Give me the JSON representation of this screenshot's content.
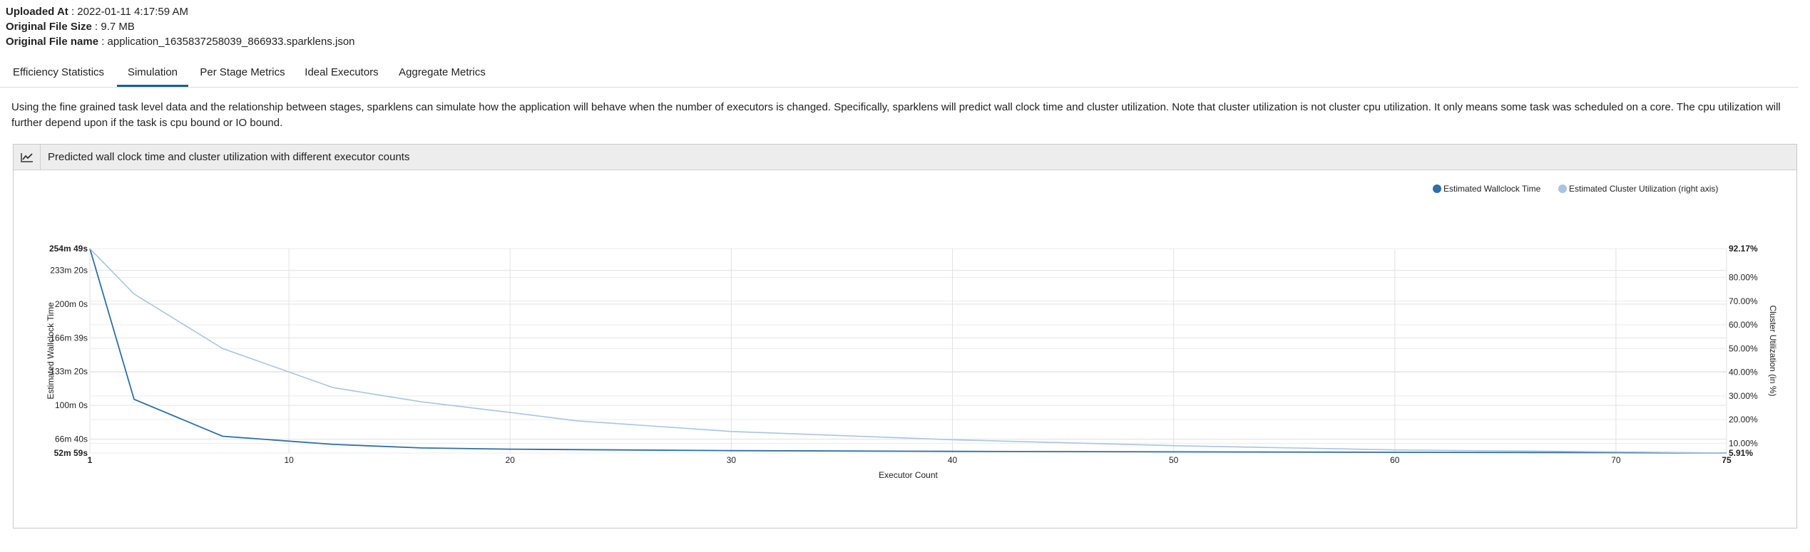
{
  "meta": {
    "uploaded_label": "Uploaded At",
    "uploaded_value": " : 2022-01-11 4:17:59 AM",
    "size_label": "Original File Size",
    "size_value": " : 9.7 MB",
    "name_label": "Original File name",
    "name_value": " : application_1635837258039_866933.sparklens.json"
  },
  "tabs": [
    {
      "label": "Efficiency Statistics"
    },
    {
      "label": "Simulation"
    },
    {
      "label": "Per Stage Metrics"
    },
    {
      "label": "Ideal Executors"
    },
    {
      "label": "Aggregate Metrics"
    }
  ],
  "active_tab": "Simulation",
  "description": "Using the fine grained task level data and the relationship between stages, sparklens can simulate how the application will behave when the number of executors is changed. Specifically, sparklens will predict wall clock time and cluster utilization. Note that cluster utilization is not cluster cpu utilization. It only means some task was scheduled on a core. The cpu utilization will further depend upon if the task is cpu bound or IO bound.",
  "panel": {
    "icon": "line-chart-icon",
    "title": "Predicted wall clock time and cluster utilization with different executor counts"
  },
  "chart_data": {
    "type": "line",
    "xlabel": "Executor Count",
    "ylabel_left": "Estimated Wallclock Time",
    "ylabel_right": "Cluster Utilization (in %)",
    "x_ticks": [
      1,
      10,
      20,
      30,
      40,
      50,
      60,
      70,
      75
    ],
    "x_range": [
      1,
      75
    ],
    "y_left_range_minutes": [
      52.983,
      254.817
    ],
    "y_left_ticks": [
      {
        "value": 254.817,
        "label": "254m 49s",
        "bold": true
      },
      {
        "value": 233.333,
        "label": "233m 20s"
      },
      {
        "value": 200.0,
        "label": "200m 0s"
      },
      {
        "value": 166.65,
        "label": "166m 39s"
      },
      {
        "value": 133.333,
        "label": "133m 20s"
      },
      {
        "value": 100.0,
        "label": "100m 0s"
      },
      {
        "value": 66.667,
        "label": "66m 40s"
      },
      {
        "value": 52.983,
        "label": "52m 59s",
        "bold": true
      }
    ],
    "y_right_range": [
      5.91,
      92.17
    ],
    "y_right_ticks": [
      {
        "value": 92.17,
        "label": "92.17%",
        "bold": true
      },
      {
        "value": 80,
        "label": "80.00%"
      },
      {
        "value": 70,
        "label": "70.00%"
      },
      {
        "value": 60,
        "label": "60.00%"
      },
      {
        "value": 50,
        "label": "50.00%"
      },
      {
        "value": 40,
        "label": "40.00%"
      },
      {
        "value": 30,
        "label": "30.00%"
      },
      {
        "value": 20,
        "label": "20.00%"
      },
      {
        "value": 10,
        "label": "10.00%"
      },
      {
        "value": 5.91,
        "label": "5.91%",
        "bold": true
      }
    ],
    "series": [
      {
        "name": "Estimated Wallclock Time",
        "axis": "left",
        "color": "#2f6fa3",
        "x": [
          1,
          3,
          7,
          12,
          16,
          20,
          25,
          30,
          40,
          50,
          60,
          70,
          75
        ],
        "y": [
          254.817,
          106,
          69.5,
          61.5,
          58,
          56.8,
          56,
          55.3,
          54.6,
          54.1,
          53.7,
          53.3,
          52.983
        ]
      },
      {
        "name": "Estimated Cluster Utilization (right axis)",
        "axis": "right",
        "color": "#a9c4e2",
        "x": [
          1,
          3,
          7,
          12,
          16,
          20,
          23,
          30,
          40,
          50,
          60,
          70,
          75
        ],
        "y": [
          92.17,
          73,
          50,
          33.5,
          27.5,
          23,
          19.5,
          15,
          11.5,
          9,
          7.2,
          6.4,
          5.91
        ]
      }
    ]
  }
}
